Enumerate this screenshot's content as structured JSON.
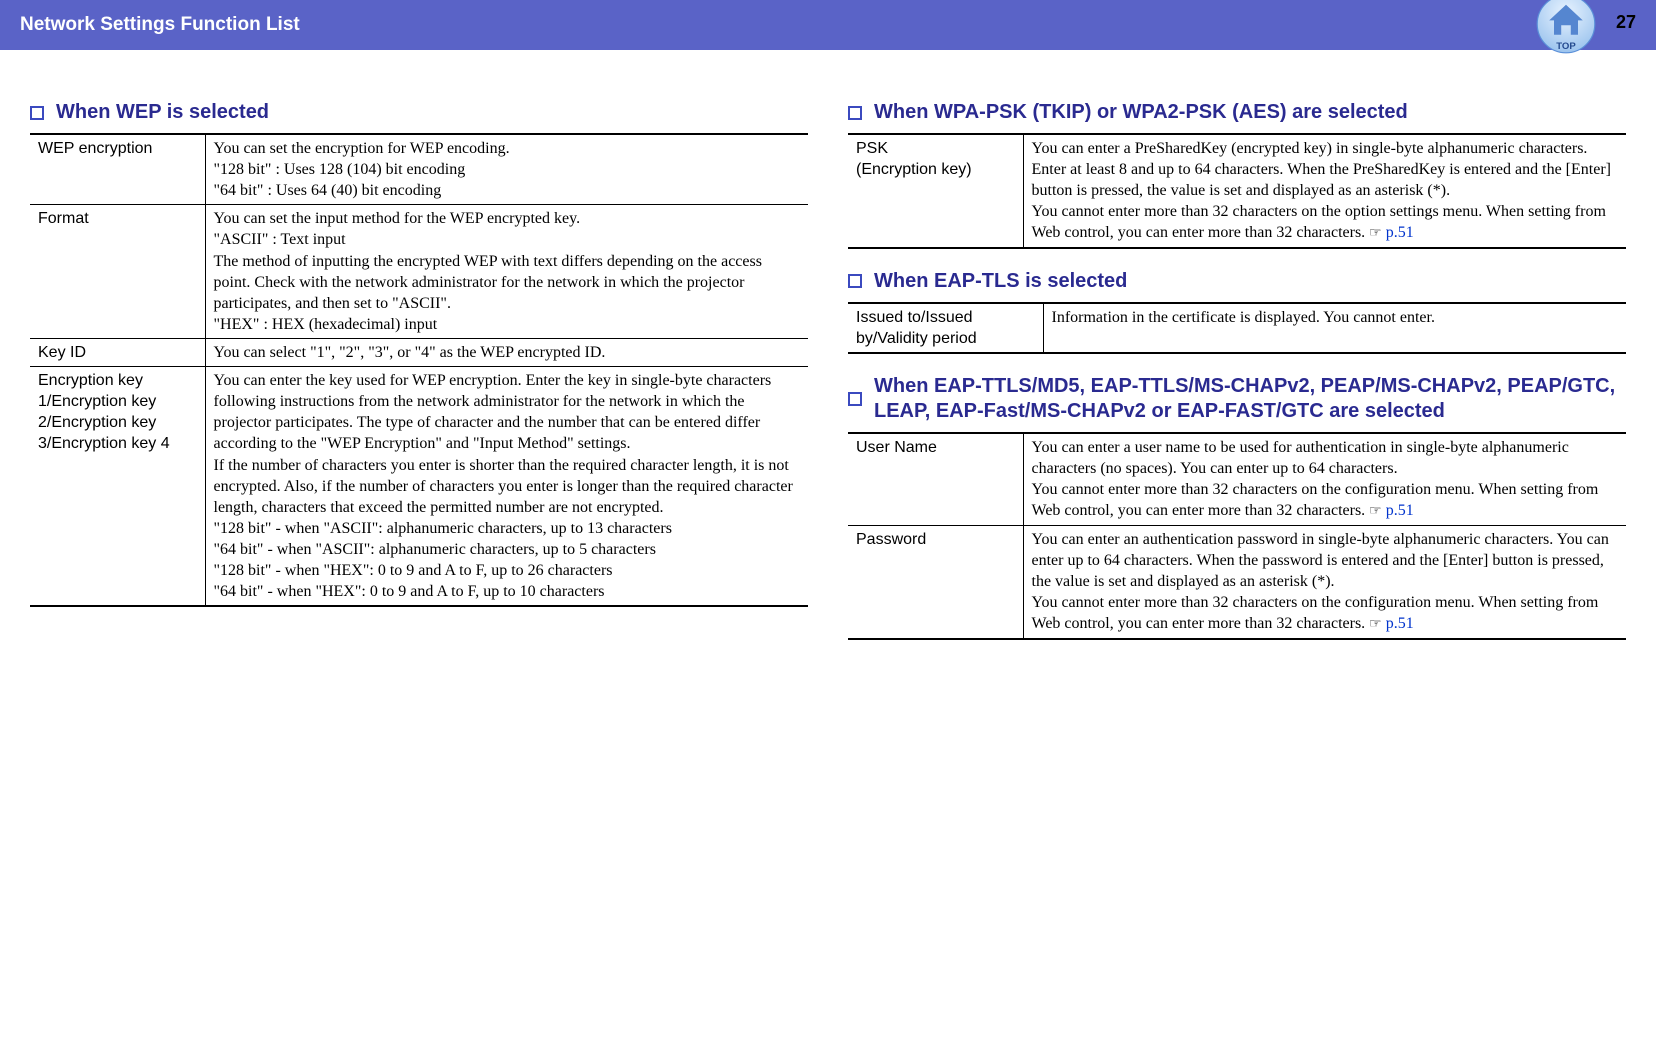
{
  "header": {
    "title": "Network Settings Function List",
    "page_number": "27",
    "top_label": "TOP"
  },
  "left": {
    "sec1": {
      "title": "When WEP is selected",
      "rows": {
        "r0": {
          "label": "WEP encryption",
          "desc": "You can set the encryption for WEP encoding.\n\"128 bit\" : Uses 128 (104) bit encoding\n\"64 bit\" : Uses 64 (40) bit encoding"
        },
        "r1": {
          "label": "Format",
          "desc": "You can set the input method for the WEP encrypted key.\n\"ASCII\" : Text input\nThe method of inputting the encrypted WEP with text differs depending on the access point. Check with the network administrator for the network in which the projector participates, and then set to \"ASCII\".\n\"HEX\" : HEX (hexadecimal) input"
        },
        "r2": {
          "label": "Key ID",
          "desc": "You can select \"1\", \"2\", \"3\", or \"4\" as the WEP encrypted ID."
        },
        "r3": {
          "label": "Encryption key 1/Encryption key 2/Encryption key 3/Encryption key 4",
          "desc": "You can enter the key used for WEP encryption. Enter the key in single-byte characters following instructions from the network administrator for the network in which the projector participates. The type of character and the number that can be entered differ according to the \"WEP Encryption\" and \"Input Method\" settings.\nIf the number of characters you enter is shorter than the required character length, it is not encrypted. Also, if the number of characters you enter is longer than the required character length, characters that exceed the permitted number are not encrypted.\n\"128 bit\" - when \"ASCII\": alphanumeric characters, up to 13 characters\n\"64 bit\" - when \"ASCII\": alphanumeric characters, up to 5 characters\n\"128 bit\" - when \"HEX\": 0 to 9 and A to F, up to 26 characters\n\"64 bit\" - when \"HEX\": 0 to 9 and A to F, up to 10 characters"
        }
      }
    }
  },
  "right": {
    "sec1": {
      "title": "When WPA-PSK (TKIP) or WPA2-PSK (AES) are selected",
      "rows": {
        "r0": {
          "label": "PSK\n(Encryption key)",
          "desc_a": "You can enter a PreSharedKey (encrypted key) in single-byte alphanumeric characters. Enter at least 8 and up to 64 characters. When the PreSharedKey is entered and the [Enter] button is pressed, the value is set and displayed as an asterisk (*).\nYou cannot enter more than 32 characters on the option settings menu. When setting from Web control, you can enter more than 32 characters. ",
          "link": "p.51"
        }
      }
    },
    "sec2": {
      "title": "When EAP-TLS is selected",
      "rows": {
        "r0": {
          "label": "Issued to/Issued by/Validity period",
          "desc": "Information in the certificate is displayed. You cannot enter."
        }
      }
    },
    "sec3": {
      "title": "When EAP-TTLS/MD5, EAP-TTLS/MS-CHAPv2, PEAP/MS-CHAPv2, PEAP/GTC, LEAP, EAP-Fast/MS-CHAPv2 or EAP-FAST/GTC are selected",
      "rows": {
        "r0": {
          "label": "User Name",
          "desc_a": "You can enter a user name to be used for authentication in single-byte alphanumeric characters (no spaces). You can enter up to 64 characters.\nYou cannot enter more than 32 characters on the configuration menu. When setting from Web control, you can enter more than 32 characters. ",
          "link": "p.51"
        },
        "r1": {
          "label": "Password",
          "desc_a": "You can enter an authentication password in single-byte alphanumeric characters. You can enter up to 64 characters. When the password is entered and the [Enter] button is pressed, the value is set and displayed as an asterisk (*).\nYou cannot enter more than 32 characters on the configuration menu. When setting from Web control, you can enter more than 32 characters. ",
          "link": "p.51"
        }
      }
    }
  }
}
